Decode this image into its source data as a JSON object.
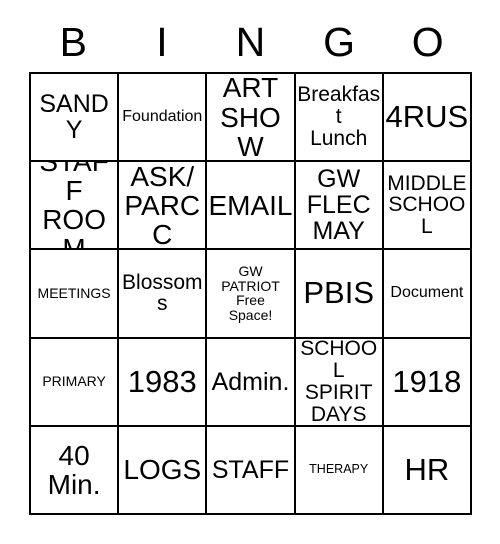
{
  "card": {
    "title_letters": [
      "B",
      "I",
      "N",
      "G",
      "O"
    ],
    "columns": 5,
    "rows": 5,
    "free_space_index": {
      "row": 2,
      "col": 2
    },
    "colors": {
      "background": "#ffffff",
      "grid_line": "#000000",
      "text": "#000000"
    },
    "cells": [
      [
        {
          "text": "SANDY",
          "size": "lg"
        },
        {
          "text": "Foundation",
          "size": "sm"
        },
        {
          "text": "ART\nSHOW",
          "size": "xl"
        },
        {
          "text": "Breakfast\nLunch",
          "size": "md"
        },
        {
          "text": "4RUS",
          "size": "xxl"
        }
      ],
      [
        {
          "text": "STAFF\nROOM",
          "size": "xl"
        },
        {
          "text": "ASK/\nPARCC",
          "size": "xl"
        },
        {
          "text": "EMAIL",
          "size": "xl"
        },
        {
          "text": "GW\nFLEC\nMAY",
          "size": "lg"
        },
        {
          "text": "MIDDLE\nSCHOOL",
          "size": "md"
        }
      ],
      [
        {
          "text": "MEETINGS",
          "size": "xs"
        },
        {
          "text": "Blossoms",
          "size": "md"
        },
        {
          "text": "GW\nPATRIOT\nFree\nSpace!",
          "size": "xs"
        },
        {
          "text": "PBIS",
          "size": "xxl"
        },
        {
          "text": "Document",
          "size": "sm"
        }
      ],
      [
        {
          "text": "PRIMARY",
          "size": "xs"
        },
        {
          "text": "1983",
          "size": "xxl"
        },
        {
          "text": "Admin.",
          "size": "lg"
        },
        {
          "text": "SCHOOL\nSPIRIT\nDAYS",
          "size": "md"
        },
        {
          "text": "1918",
          "size": "xxl"
        }
      ],
      [
        {
          "text": "40\nMin.",
          "size": "xl"
        },
        {
          "text": "LOGS",
          "size": "xl"
        },
        {
          "text": "STAFF",
          "size": "lg"
        },
        {
          "text": "THERAPY",
          "size": "xxs"
        },
        {
          "text": "HR",
          "size": "xxl"
        }
      ]
    ]
  }
}
